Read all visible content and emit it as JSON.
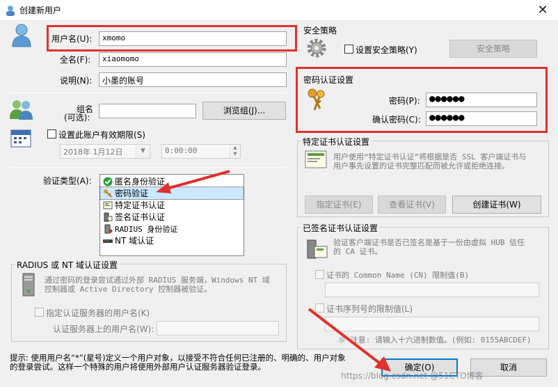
{
  "window": {
    "title": "创建新用户",
    "close": "✕"
  },
  "left": {
    "username_label": "用户名(U):",
    "username_value": "xmomo",
    "fullname_label": "全名(F):",
    "fullname_value": "xiaomomo",
    "desc_label": "说明(N):",
    "desc_value": "小墨的账号",
    "group_label_1": "组名",
    "group_label_2": "(可选):",
    "group_value": "",
    "browse_group": "浏览组(J)...",
    "expire_label": "设置此账户有效期限(S)",
    "date_value": "2018年 1月12日",
    "time_value": "0:00:00",
    "auth_type_label": "验证类型(A):",
    "auth_types": [
      "匿名身份验证",
      "密码验证",
      "特定证书认证",
      "签名证书认证",
      "RADIUS 身份验证",
      "NT 域认证"
    ],
    "radius_group_title": "RADIUS 或 NT 域认证设置",
    "radius_desc_1": "通过密码的登录尝试通过外部 RADIUS 服务端，Windows NT 域",
    "radius_desc_2": "控制器或 Active Directory 控制器被验证。",
    "radius_specify_label": "指定认证服务器的用户名(K)",
    "radius_server_user_label": "认证服务器上的用户名(W):",
    "radius_server_user_value": ""
  },
  "right": {
    "security_policy_title": "安全策略",
    "security_policy_checkbox": "设置安全策略(Y)",
    "security_policy_button": "安全策略",
    "password_group_title": "密码认证设置",
    "password_label": "密码(P):",
    "password_value": "●●●●●●",
    "confirm_label": "确认密码(C):",
    "confirm_value": "●●●●●●",
    "cert_group_title": "特定证书认证设置",
    "cert_desc_1": "用户使用“特定证书认证”将根据是否 SSL 客户端证书与",
    "cert_desc_2": "用户事先设置的证书完整匹配而被允许或拒绝连接。",
    "specify_cert": "指定证书(E)",
    "view_cert": "查看证书(V)",
    "create_cert": "创建证书(W)",
    "signed_group_title": "已签名证书认证设置",
    "signed_desc_1": "验证客户端证书是否已签名是基于一份由虚拟 HUB 信任",
    "signed_desc_2": "的 CA 证书。",
    "cn_label": "证书的 Common Name (CN) 限制值(B)",
    "cn_value": "",
    "serial_label": "证书序列号的限制值(L)",
    "serial_value": "",
    "note": "※ 注意: 请输入十六进制数值。(例如: 0155ABCDEF)"
  },
  "footer": {
    "hint_1": "提示: 使用用户名“*”(星号)定义一个用户对象，以接受不符合任何已注册的、明确的、用户对象",
    "hint_2": "的登录尝试。这样一个特殊的用户将使用外部用户认证服务器验证登录。",
    "ok": "确定(O)",
    "cancel": "取消"
  },
  "watermark": "https://blog.csdn.net @51CTO博客",
  "colors": {
    "highlight": "#e0312c",
    "selection": "#cce8ff",
    "accent": "#0078d7"
  }
}
